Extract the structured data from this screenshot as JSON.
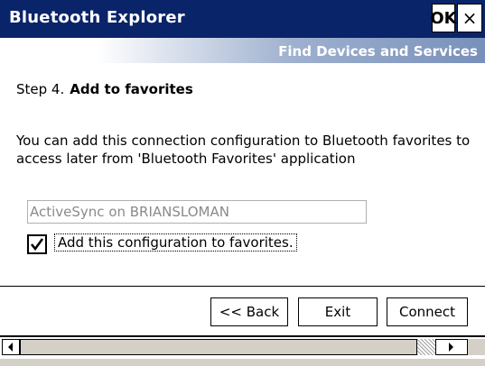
{
  "window": {
    "title": "Bluetooth Explorer",
    "ok_label": "OK",
    "close_label": "×",
    "subtitle": "Find Devices and Services"
  },
  "step": {
    "number_label": "Step 4.",
    "title": "Add to favorites"
  },
  "description": "You can add this connection configuration to Bluetooth favorites to access later from 'Bluetooth Favorites' application",
  "name_field": {
    "value": "ActiveSync on BRIANSLOMAN"
  },
  "favorites_checkbox": {
    "label": "Add this configuration to favorites.",
    "checked": true
  },
  "buttons": {
    "back": "<< Back",
    "exit": "Exit",
    "connect": "Connect"
  },
  "colors": {
    "titlebar": "#0a246a",
    "subheader_end": "#7890ba"
  },
  "icons": {
    "scroll_left": "left-arrow-icon",
    "scroll_right": "right-arrow-icon",
    "check": "checkmark-icon"
  }
}
